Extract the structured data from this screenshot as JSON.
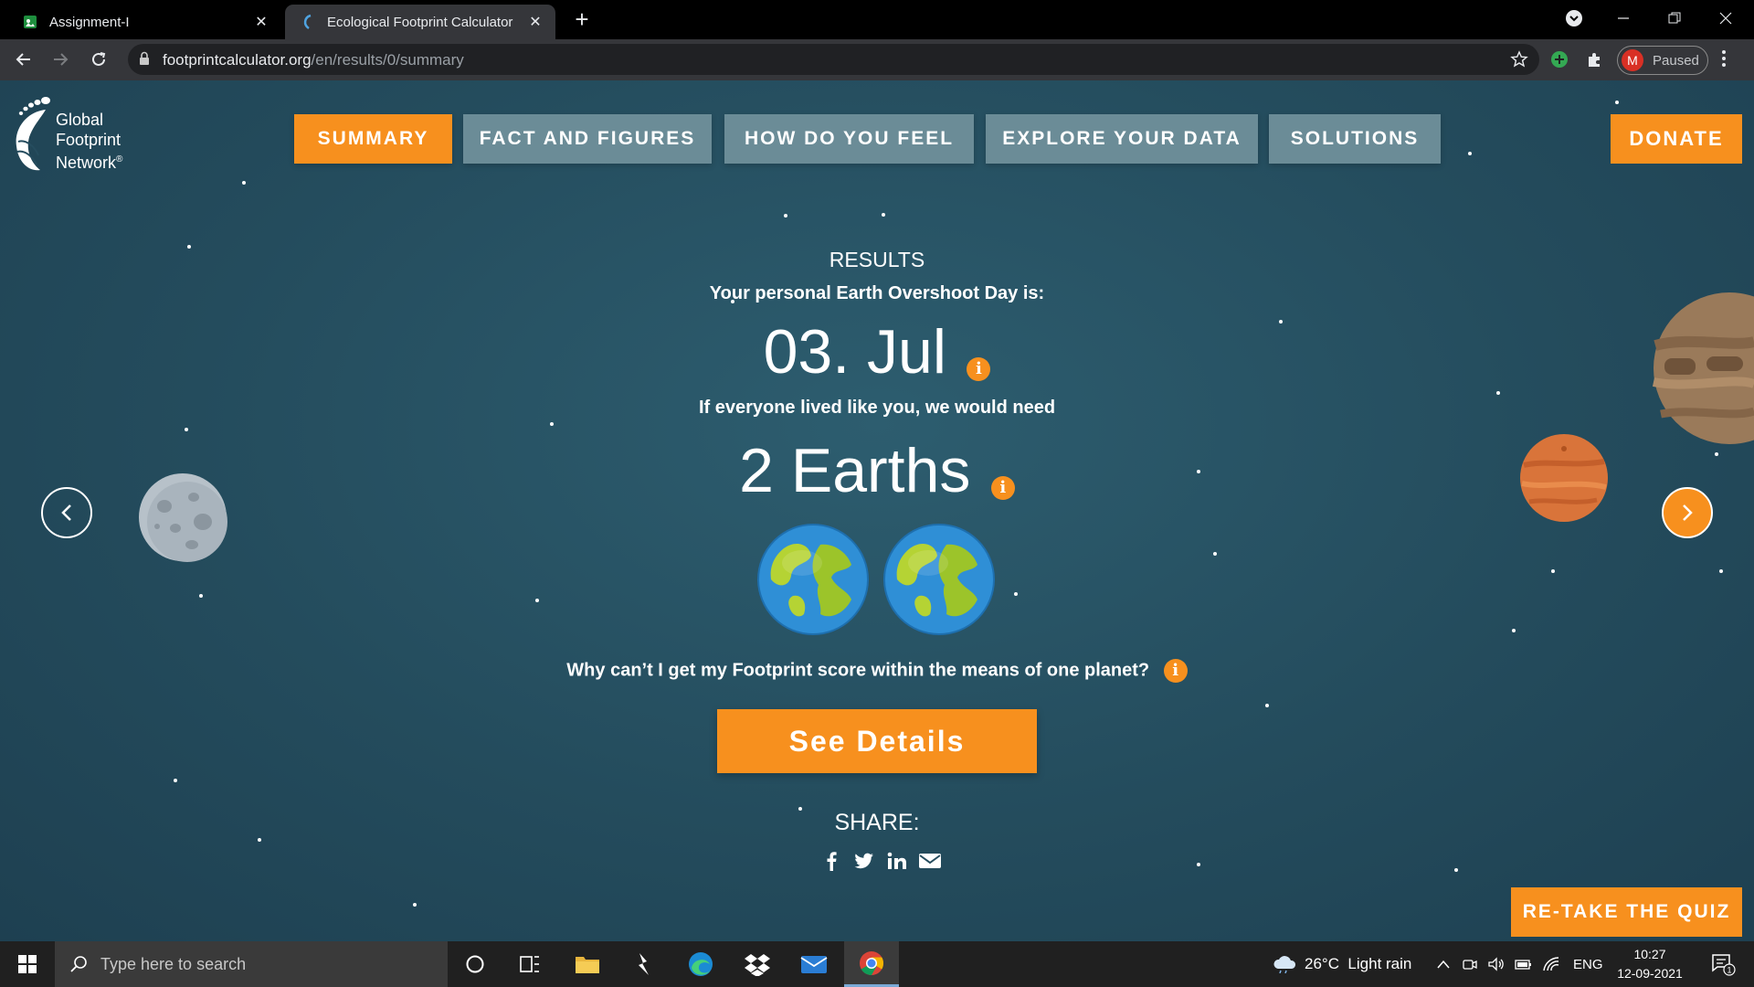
{
  "browser": {
    "tabs": [
      {
        "title": "Assignment-I",
        "active": false
      },
      {
        "title": "Ecological Footprint Calculator",
        "active": true
      }
    ],
    "url_host": "footprintcalculator.org",
    "url_path": "/en/results/0/summary",
    "profile_initial": "M",
    "profile_status": "Paused"
  },
  "site": {
    "logo_lines": [
      "Global",
      "Footprint",
      "Network"
    ],
    "logo_mark": "®",
    "nav": [
      "SUMMARY",
      "FACT AND FIGURES",
      "HOW DO YOU FEEL",
      "EXPLORE YOUR DATA",
      "SOLUTIONS"
    ],
    "active_nav": "SUMMARY",
    "donate": "DONATE"
  },
  "results": {
    "heading": "RESULTS",
    "overshoot_label": "Your personal Earth Overshoot Day is:",
    "overshoot_date": "03. Jul",
    "need_label": "If everyone lived like you, we would need",
    "earths_text": "2 Earths",
    "earths_count": 2,
    "why_text": "Why can’t I get my Footprint score within the means of one planet?",
    "see_details": "See Details",
    "share_label": "SHARE:",
    "info_glyph": "i"
  },
  "actions": {
    "retake": "RE-TAKE THE QUIZ"
  },
  "taskbar": {
    "search_placeholder": "Type here to search",
    "weather": "26°C  Light rain",
    "language": "ENG",
    "time": "10:27",
    "date": "12-09-2021",
    "notification_count": "1"
  },
  "colors": {
    "accent": "#f7901e",
    "nav_inactive": "#6b8c97",
    "background": "#254c5e"
  }
}
